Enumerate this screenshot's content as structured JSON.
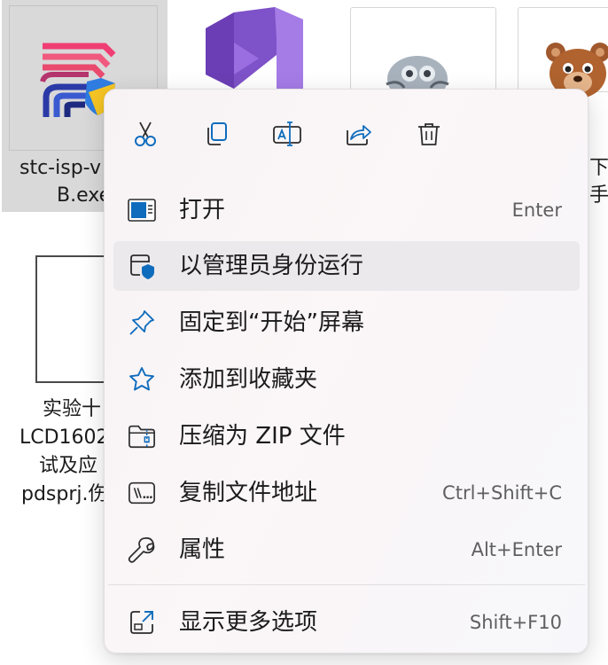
{
  "desktop": {
    "files": [
      {
        "name_line1": "stc-isp-v",
        "name_line2": "B.exe"
      },
      {
        "name_line1": "实验十",
        "name_line2": "LCD1602",
        "name_line3": "试及应",
        "name_line4": "pdsprj.伤"
      },
      {
        "partial_label_line1": "下",
        "partial_label_line2": "手"
      }
    ]
  },
  "context_menu": {
    "quick_actions": [
      {
        "icon": "cut-icon"
      },
      {
        "icon": "copy-icon"
      },
      {
        "icon": "rename-icon"
      },
      {
        "icon": "share-icon"
      },
      {
        "icon": "delete-icon"
      }
    ],
    "items": [
      {
        "label": "打开",
        "shortcut": "Enter",
        "icon": "open-window-icon"
      },
      {
        "label": "以管理员身份运行",
        "shortcut": "",
        "icon": "run-as-admin-icon"
      },
      {
        "label": "固定到“开始”屏幕",
        "shortcut": "",
        "icon": "pin-icon"
      },
      {
        "label": "添加到收藏夹",
        "shortcut": "",
        "icon": "star-icon"
      },
      {
        "label": "压缩为 ZIP 文件",
        "shortcut": "",
        "icon": "zip-folder-icon"
      },
      {
        "label": "复制文件地址",
        "shortcut": "Ctrl+Shift+C",
        "icon": "copy-path-icon"
      },
      {
        "label": "属性",
        "shortcut": "Alt+Enter",
        "icon": "wrench-icon"
      }
    ],
    "more_options": {
      "label": "显示更多选项",
      "shortcut": "Shift+F10",
      "icon": "more-options-icon"
    }
  },
  "colors": {
    "accent": "#0f6cbd",
    "hover": "#ece9ec",
    "selection": "#d9d9d9"
  }
}
